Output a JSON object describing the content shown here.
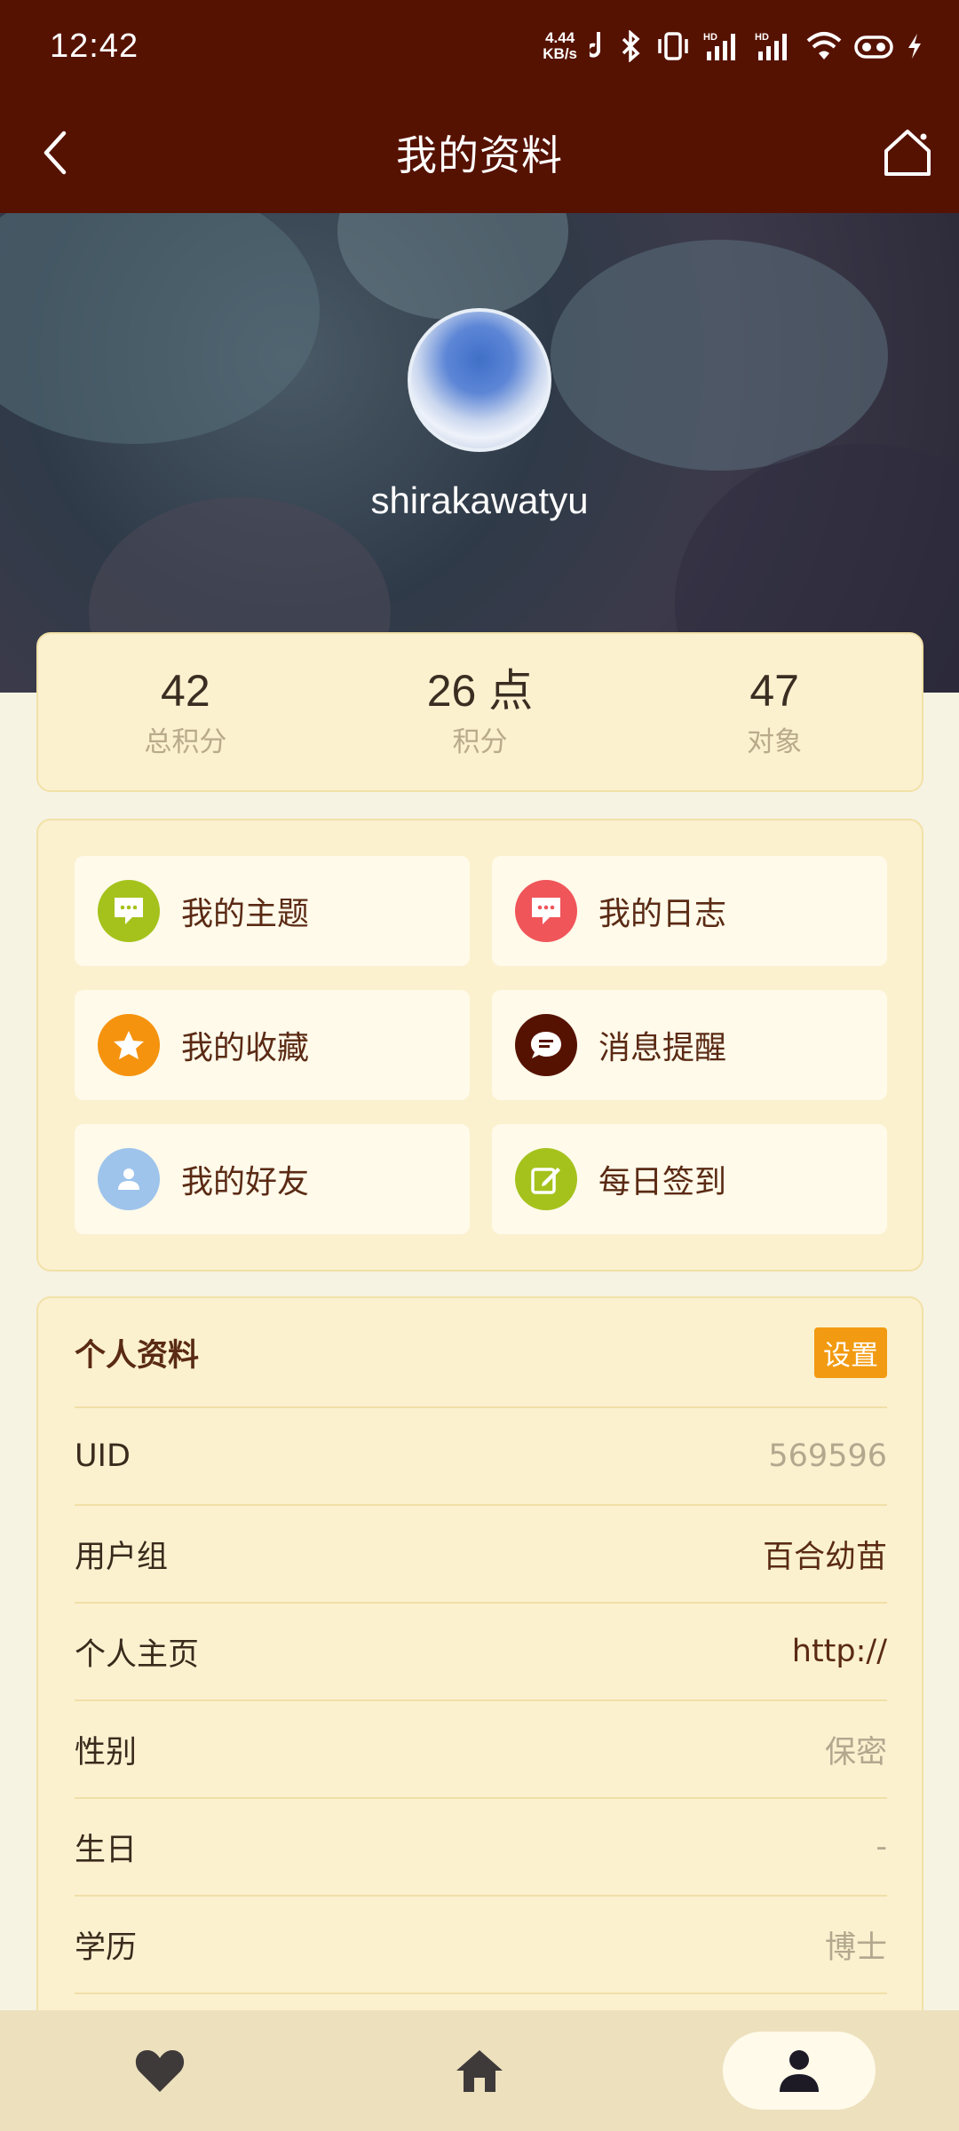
{
  "status_bar": {
    "time": "12:42",
    "netspeed_value": "4.44",
    "netspeed_unit": "KB/s",
    "icons": [
      "nfc-icon",
      "bluetooth-icon",
      "vibrate-icon",
      "signal-hd-icon",
      "signal-hd-icon",
      "wifi-icon",
      "volte-icon",
      "charging-icon"
    ]
  },
  "header": {
    "title": "我的资料",
    "back_icon": "chevron-left-icon",
    "home_icon": "home-icon"
  },
  "profile_header": {
    "username": "shirakawatyu"
  },
  "stats": [
    {
      "value": "42",
      "label": "总积分"
    },
    {
      "value": "26 点",
      "label": "积分"
    },
    {
      "value": "47",
      "label": "对象"
    }
  ],
  "menu": [
    {
      "label": "我的主题",
      "icon": "chat-bubble-icon",
      "color": "#a5c21c"
    },
    {
      "label": "我的日志",
      "icon": "chat-bubble-icon",
      "color": "#f0555a"
    },
    {
      "label": "我的收藏",
      "icon": "star-icon",
      "color": "#f5930f"
    },
    {
      "label": "消息提醒",
      "icon": "message-icon",
      "color": "#561200"
    },
    {
      "label": "我的好友",
      "icon": "user-icon",
      "color": "#9ec4ec"
    },
    {
      "label": "每日签到",
      "icon": "edit-icon",
      "color": "#a5c21c"
    }
  ],
  "profile": {
    "title": "个人资料",
    "settings_label": "设置",
    "rows": [
      {
        "key": "UID",
        "value": "569596"
      },
      {
        "key": "用户组",
        "value": "百合幼苗"
      },
      {
        "key": "个人主页",
        "value": "http://"
      },
      {
        "key": "性别",
        "value": "保密"
      },
      {
        "key": "生日",
        "value": "-"
      },
      {
        "key": "学历",
        "value": "博士"
      }
    ]
  },
  "bottom_nav": {
    "items": [
      "heart-icon",
      "home-icon",
      "user-icon"
    ],
    "active": "user-icon"
  },
  "colors": {
    "brand": "#561200",
    "card_bg": "#fbf1cf",
    "page_bg": "#f6f3e3",
    "accent": "#f29a11"
  }
}
